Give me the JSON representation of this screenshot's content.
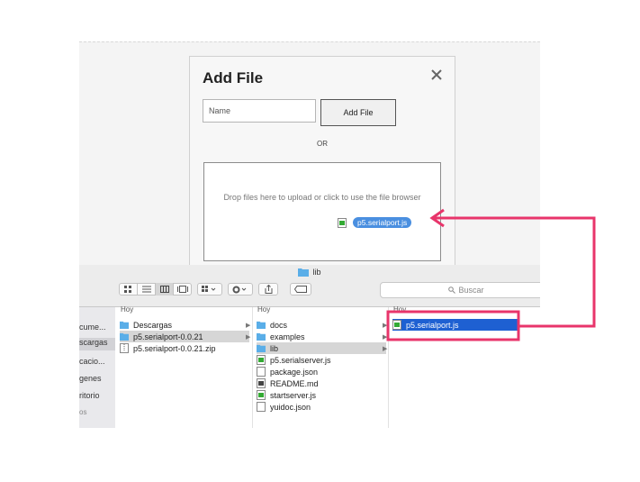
{
  "modal": {
    "title": "Add File",
    "name_placeholder": "Name",
    "add_button_label": "Add File",
    "or_text": "OR",
    "drop_text": "Drop files here to upload or click to use the file browser",
    "dragged_file": "p5.serialport.js"
  },
  "finder": {
    "window_title": "lib",
    "search_placeholder": "Buscar",
    "sidebar_items": [
      "cume...",
      "scargas",
      "cacio...",
      "genes",
      "ritorio",
      "os"
    ],
    "column1": {
      "header": "Hoy",
      "items": [
        {
          "name": "Descargas",
          "type": "folder"
        },
        {
          "name": "p5.serialport-0.0.21",
          "type": "folder"
        },
        {
          "name": "p5.serialport-0.0.21.zip",
          "type": "zip"
        }
      ]
    },
    "column2": {
      "header": "Hoy",
      "items": [
        {
          "name": "docs",
          "type": "folder"
        },
        {
          "name": "examples",
          "type": "folder"
        },
        {
          "name": "lib",
          "type": "folder"
        },
        {
          "name": "p5.serialserver.js",
          "type": "script"
        },
        {
          "name": "package.json",
          "type": "file"
        },
        {
          "name": "README.md",
          "type": "md"
        },
        {
          "name": "startserver.js",
          "type": "script"
        },
        {
          "name": "yuidoc.json",
          "type": "file"
        }
      ]
    },
    "column3": {
      "header": "Hoy",
      "items": [
        {
          "name": "p5.serialport.js",
          "type": "script"
        }
      ]
    }
  },
  "colors": {
    "annotation": "#e8356b",
    "selection": "#1e60d2",
    "drag_chip": "#4a8fe0",
    "folder": "#5aaee8"
  }
}
